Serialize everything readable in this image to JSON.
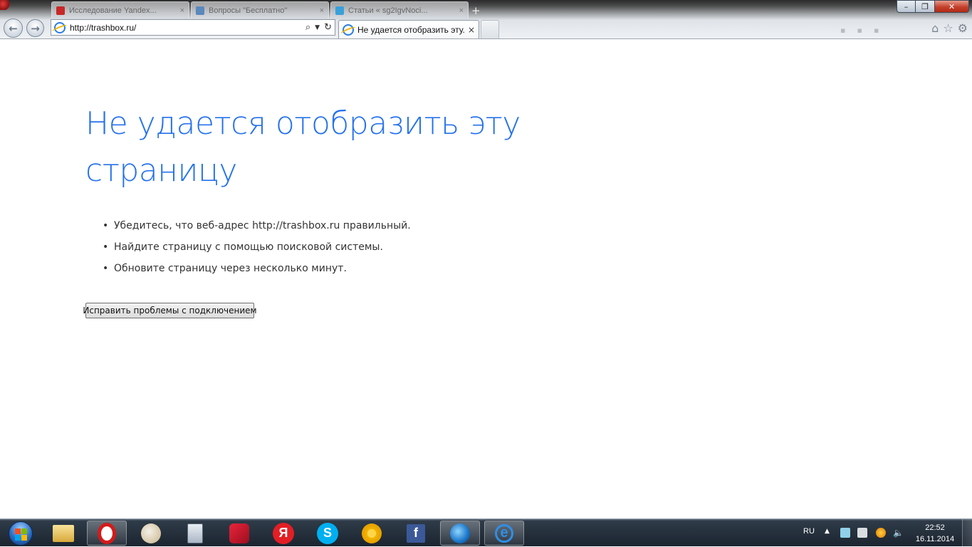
{
  "browser": {
    "address_url": "http://trashbox.ru/",
    "active_tab_title": "Не удается отобразить эту...",
    "active_tab_close": "×",
    "new_tab_symbol": "+",
    "background_tabs": [
      {
        "favicon": "opera-favicon",
        "title": "Исследование Yandex..."
      },
      {
        "favicon": "vk-favicon",
        "title": "Вопросы \"Бесплатно\""
      },
      {
        "favicon": "site-favicon",
        "title": "Статьи « sg2IgvNoci..."
      }
    ],
    "window_controls": {
      "minimize": "–",
      "maximize": "❐",
      "close": "✕"
    },
    "toolbar_icons": [
      "home-icon",
      "favorites-star-icon",
      "settings-gear-icon"
    ]
  },
  "error_page": {
    "title": "Не удается отобразить эту страницу",
    "suggestions": [
      "Убедитесь, что веб-адрес http://trashbox.ru правильный.",
      "Найдите страницу с помощью поисковой системы.",
      "Обновите страницу через несколько минут."
    ],
    "fix_button": "Исправить проблемы с подключением"
  },
  "taskbar": {
    "pinned": [
      {
        "name": "windows-explorer",
        "icon": "folder-icon",
        "running": false
      },
      {
        "name": "opera",
        "icon": "opera-icon",
        "running": true
      },
      {
        "name": "paint",
        "icon": "paint-palette-icon",
        "running": false
      },
      {
        "name": "calculator",
        "icon": "calculator-icon",
        "running": false
      },
      {
        "name": "opera-next",
        "icon": "opera-red-icon",
        "running": false
      },
      {
        "name": "yandex-browser",
        "icon": "yandex-icon",
        "running": false
      },
      {
        "name": "skype",
        "icon": "skype-icon",
        "running": false
      },
      {
        "name": "chrome",
        "icon": "chrome-icon",
        "running": false
      },
      {
        "name": "facebook",
        "icon": "facebook-icon",
        "running": false
      },
      {
        "name": "globe-app",
        "icon": "globe-icon",
        "running": true
      },
      {
        "name": "internet-explorer",
        "icon": "ie-icon",
        "running": true
      }
    ],
    "tray": {
      "language": "RU",
      "time": "22:52",
      "date": "16.11.2014"
    }
  }
}
